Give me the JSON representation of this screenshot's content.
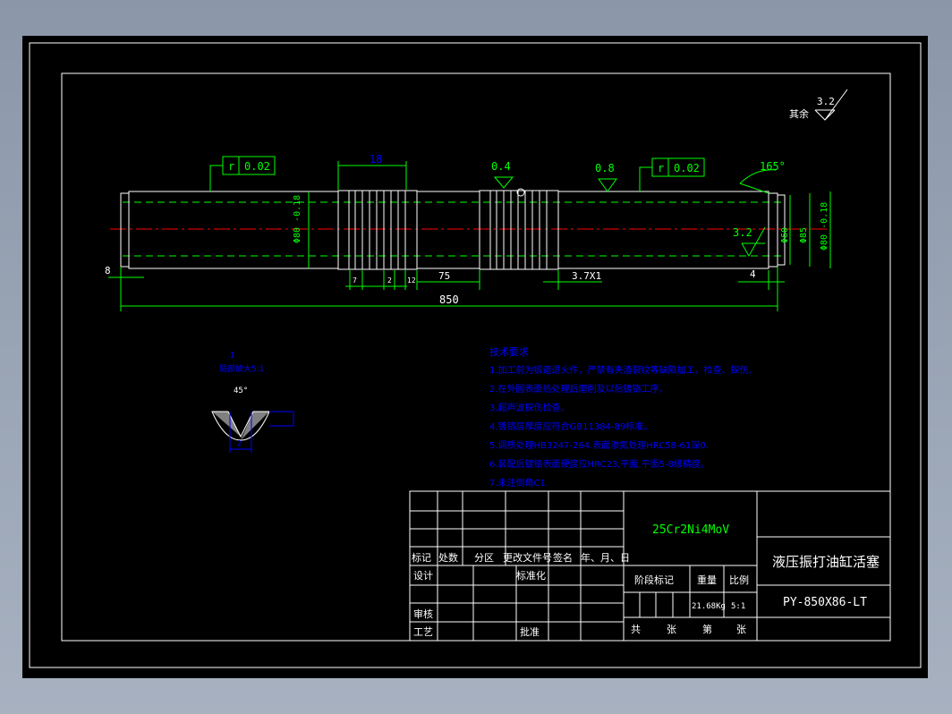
{
  "drawing": {
    "roughness_default": {
      "label": "其余",
      "value": "3.2"
    },
    "dimensions": {
      "total_length": "850",
      "left_offset": "8",
      "groove_spacing": "75",
      "groove_pitch": "3.7X1",
      "right_offset": "4",
      "g1": "7",
      "g2": "2",
      "g3": "12",
      "top_group": "18",
      "angle": "165°",
      "dia1": "Φ80 -0.18",
      "dia2": "Φ80 -0.18",
      "dia3": "Φ60",
      "dia4": "Φ85",
      "dia5": "Φ80 -0.18"
    },
    "roughness": [
      "0.4",
      "0.8",
      "3.2"
    ],
    "tolerances": [
      {
        "symbol": "r",
        "value": "0.02"
      },
      {
        "symbol": "r",
        "value": "0.02"
      }
    ],
    "detail": {
      "label": "I",
      "scale": "局部放大5:1",
      "angle": "45°",
      "dim": "2"
    },
    "notes_title": "技术要求",
    "notes": [
      "1.加工前为锻造退火件，严禁有夹渣裂纹等缺陷加工，检查、探伤。",
      "2.在外圆表面热处理后磨削及以后镀铬工序。",
      "3.超声波探伤检查。",
      "4.镀铬层厚度应符合GB11384-89标准。",
      "5.调质处理HB3247-264.表面渗氮处理HRC58-61深0.",
      "6.装配后镀铬表面硬度应HRC23,平面,平面5-8级精度。",
      "7.未注倒角C1"
    ]
  },
  "title_block": {
    "material": "25Cr2Ni4MoV",
    "part_name": "液压振打油缸活塞",
    "drawing_no": "PY-850X86-LT",
    "weight": "21.68Kg",
    "scale": "5:1",
    "labels": {
      "mark": "标记",
      "count": "处数",
      "zone": "分区",
      "change_doc": "更改文件号",
      "sign": "签名",
      "date": "年、月、日",
      "design": "设计",
      "standardize": "标准化",
      "stage_mark": "阶段标记",
      "weight_label": "重量",
      "scale_label": "比例",
      "review": "审核",
      "process": "工艺",
      "approve": "批准",
      "total": "共",
      "sheets": "张",
      "page": "第",
      "sheet2": "张"
    }
  },
  "colors": {
    "line": "#ffffff",
    "dimension": "#00ff00",
    "annotation": "#0000ff",
    "centerline": "#ff0000",
    "hidden": "#00ff00"
  }
}
